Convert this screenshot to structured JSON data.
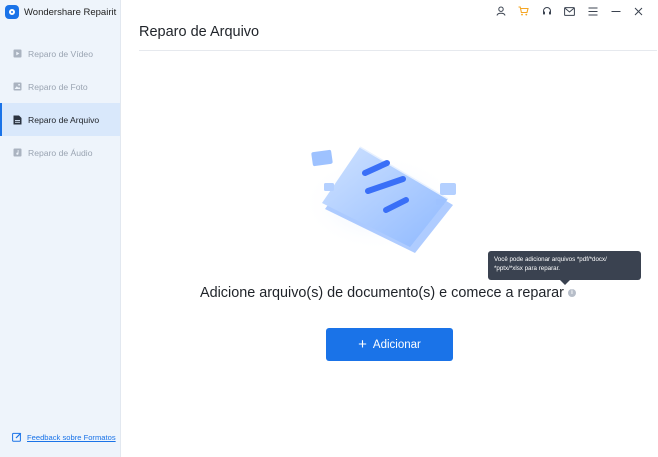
{
  "app": {
    "name": "Wondershare Repairit"
  },
  "sidebar": {
    "items": [
      {
        "label": "Reparo de Vídeo",
        "icon": "video-icon",
        "active": false
      },
      {
        "label": "Reparo de Foto",
        "icon": "image-icon",
        "active": false
      },
      {
        "label": "Reparo de Arquivo",
        "icon": "document-icon",
        "active": true
      },
      {
        "label": "Reparo de Áudio",
        "icon": "audio-icon",
        "active": false
      }
    ],
    "feedback_label": "Feedback sobre Formatos"
  },
  "topbar": {
    "icons": [
      "user-icon",
      "cart-icon",
      "headset-icon",
      "mail-icon",
      "menu-icon",
      "minimize-icon",
      "close-icon"
    ],
    "cart_color": "#f5a623"
  },
  "main": {
    "title": "Reparo de Arquivo",
    "tooltip": "Você pode adicionar arquivos *pdf/*docx/ *pptx/*xlsx para reparar.",
    "message": "Adicione arquivo(s) de documento(s) e comece a reparar",
    "add_button": {
      "label": "Adicionar"
    }
  },
  "colors": {
    "accent": "#1a73e8",
    "sidebar_bg": "#eef4fb"
  }
}
